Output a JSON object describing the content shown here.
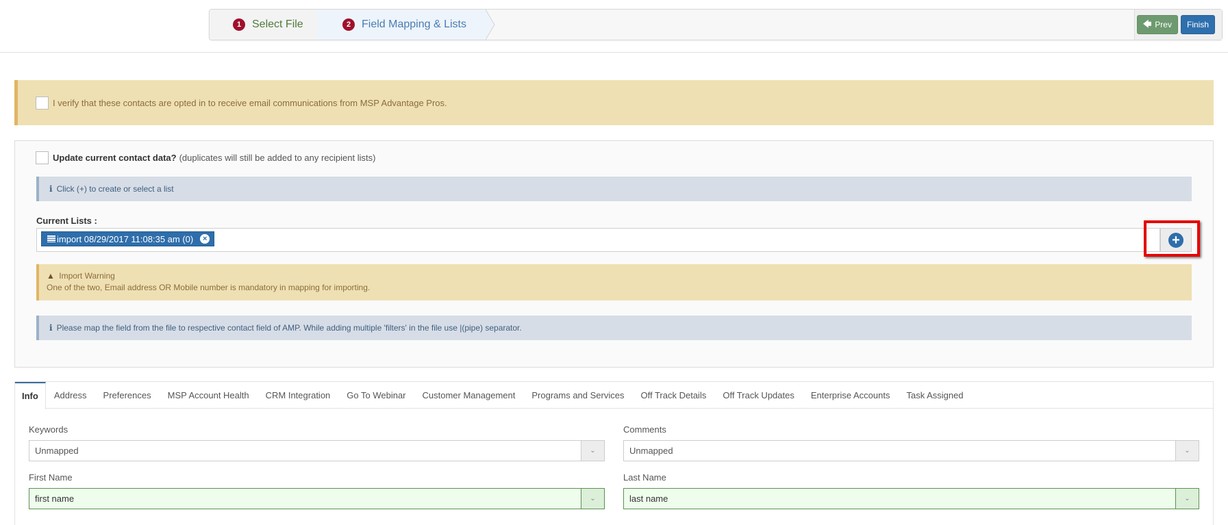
{
  "wizard": {
    "steps": [
      {
        "number": "1",
        "label": "Select File"
      },
      {
        "number": "2",
        "label": "Field Mapping & Lists"
      }
    ],
    "prev_label": "Prev",
    "finish_label": "Finish"
  },
  "optin": {
    "checked": false,
    "text": "I verify that these contacts are opted in to receive email communications from MSP Advantage Pros."
  },
  "update": {
    "checked": false,
    "label_bold": "Update current contact data?",
    "label_note": "(duplicates will still be added to any recipient lists)"
  },
  "info_create_list": "Click (+) to create or select a list",
  "current_lists": {
    "label": "Current Lists :",
    "tags": [
      "import 08/29/2017 11:08:35 am (0)"
    ],
    "add_button": "+"
  },
  "warning": {
    "title": "Import Warning",
    "text": "One of the two, Email address OR Mobile number is mandatory in mapping for importing."
  },
  "info_mapping": "Please map the field from the file to respective contact field of AMP.  While adding multiple 'filters' in the file use |(pipe) separator.",
  "tabs": [
    "Info",
    "Address",
    "Preferences",
    "MSP Account Health",
    "CRM Integration",
    "Go To Webinar",
    "Customer Management",
    "Programs and Services",
    "Off Track Details",
    "Off Track Updates",
    "Enterprise Accounts",
    "Task Assigned"
  ],
  "active_tab": "Info",
  "fields": {
    "keywords": {
      "label": "Keywords",
      "value": "Unmapped"
    },
    "comments": {
      "label": "Comments",
      "value": "Unmapped"
    },
    "first_name": {
      "label": "First Name",
      "value": "first name"
    },
    "last_name": {
      "label": "Last Name",
      "value": "last name"
    }
  },
  "colors": {
    "step_badge": "#a0102c",
    "prev_button": "#6e9a70",
    "finish_button": "#2e6fad",
    "warning_bg": "#efe0b3",
    "info_bg": "#d7dde6",
    "mapped_bg": "#eefdec",
    "highlight": "#e60000"
  }
}
